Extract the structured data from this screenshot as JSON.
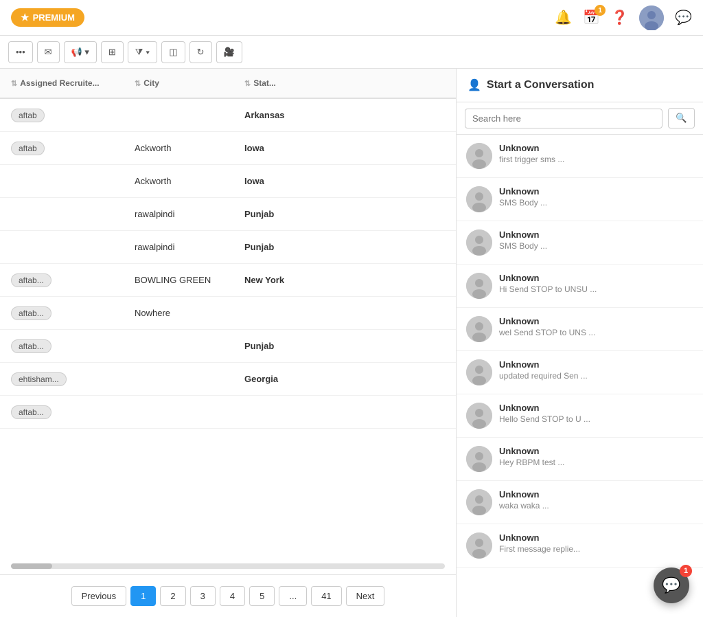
{
  "topnav": {
    "premium_label": "PREMIUM",
    "calendar_badge": "1",
    "chat_widget_badge": "1"
  },
  "toolbar": {
    "buttons": [
      "...",
      "✉",
      "📢 ▾",
      "⊞",
      "⧩ ▾",
      "◫",
      "↻",
      "🎥"
    ]
  },
  "columns": {
    "assigned_recruiter": "Assigned Recruite...",
    "city": "City",
    "state": "Stat..."
  },
  "rows": [
    {
      "tag": "aftab",
      "city": "",
      "state": "Arkansas"
    },
    {
      "tag": "aftab",
      "city": "Ackworth",
      "state": "Iowa"
    },
    {
      "tag": "",
      "city": "Ackworth",
      "state": "Iowa"
    },
    {
      "tag": "",
      "city": "rawalpindi",
      "state": "Punjab"
    },
    {
      "tag": "",
      "city": "rawalpindi",
      "state": "Punjab"
    },
    {
      "tag": "aftab...",
      "city": "BOWLING GREEN",
      "state": "New York"
    },
    {
      "tag": "aftab...",
      "city": "Nowhere",
      "state": ""
    },
    {
      "tag": "aftab...",
      "city": "",
      "state": "Punjab"
    },
    {
      "tag": "ehtisham...",
      "city": "",
      "state": "Georgia"
    },
    {
      "tag": "aftab...",
      "city": "",
      "state": ""
    }
  ],
  "pagination": {
    "previous": "Previous",
    "next": "Next",
    "pages": [
      "1",
      "2",
      "3",
      "4",
      "5",
      "...",
      "41"
    ],
    "active_page": "1"
  },
  "right_panel": {
    "title": "Start a Conversation",
    "search_placeholder": "Search here",
    "conversations": [
      {
        "name": "Unknown",
        "preview": "first trigger sms ..."
      },
      {
        "name": "Unknown",
        "preview": "SMS Body ..."
      },
      {
        "name": "Unknown",
        "preview": "SMS Body ..."
      },
      {
        "name": "Unknown",
        "preview": "Hi Send STOP to UNSU ..."
      },
      {
        "name": "Unknown",
        "preview": "wel Send STOP to UNS ..."
      },
      {
        "name": "Unknown",
        "preview": "updated required Sen ..."
      },
      {
        "name": "Unknown",
        "preview": "Hello Send STOP to U ..."
      },
      {
        "name": "Unknown",
        "preview": "Hey RBPM test ..."
      },
      {
        "name": "Unknown",
        "preview": "waka waka ..."
      },
      {
        "name": "Unknown",
        "preview": "First message replie..."
      }
    ]
  }
}
